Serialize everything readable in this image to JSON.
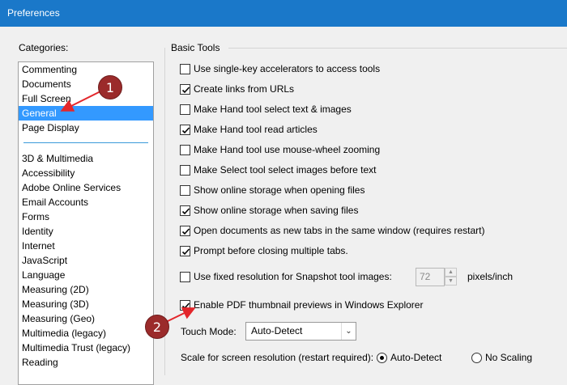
{
  "window": {
    "title": "Preferences"
  },
  "categories": {
    "label": "Categories:",
    "top_items": [
      {
        "label": "Commenting",
        "selected": false
      },
      {
        "label": "Documents",
        "selected": false
      },
      {
        "label": "Full Screen",
        "selected": false
      },
      {
        "label": "General",
        "selected": true
      },
      {
        "label": "Page Display",
        "selected": false
      }
    ],
    "items": [
      {
        "label": "3D & Multimedia"
      },
      {
        "label": "Accessibility"
      },
      {
        "label": "Adobe Online Services"
      },
      {
        "label": "Email Accounts"
      },
      {
        "label": "Forms"
      },
      {
        "label": "Identity"
      },
      {
        "label": "Internet"
      },
      {
        "label": "JavaScript"
      },
      {
        "label": "Language"
      },
      {
        "label": "Measuring (2D)"
      },
      {
        "label": "Measuring (3D)"
      },
      {
        "label": "Measuring (Geo)"
      },
      {
        "label": "Multimedia (legacy)"
      },
      {
        "label": "Multimedia Trust (legacy)"
      },
      {
        "label": "Reading"
      }
    ]
  },
  "basic_tools": {
    "title": "Basic Tools",
    "options": [
      {
        "label": "Use single-key accelerators to access tools",
        "checked": false
      },
      {
        "label": "Create links from URLs",
        "checked": true
      },
      {
        "label": "Make Hand tool select text & images",
        "checked": false
      },
      {
        "label": "Make Hand tool read articles",
        "checked": true
      },
      {
        "label": "Make Hand tool use mouse-wheel zooming",
        "checked": false
      },
      {
        "label": "Make Select tool select images before text",
        "checked": false
      },
      {
        "label": "Show online storage when opening files",
        "checked": false
      },
      {
        "label": "Show online storage when saving files",
        "checked": true
      },
      {
        "label": "Open documents as new tabs in the same window (requires restart)",
        "checked": true
      },
      {
        "label": "Prompt before closing multiple tabs.",
        "checked": true
      }
    ],
    "snapshot": {
      "label": "Use fixed resolution for Snapshot tool images:",
      "checked": false,
      "value": "72",
      "unit": "pixels/inch"
    },
    "thumbnail": {
      "label": "Enable PDF thumbnail previews in Windows Explorer",
      "checked": true
    },
    "touch_mode": {
      "label": "Touch Mode:",
      "value": "Auto-Detect"
    },
    "scale": {
      "label": "Scale for screen resolution (restart required):",
      "options": [
        {
          "label": "Auto-Detect",
          "checked": true
        },
        {
          "label": "No Scaling",
          "checked": false
        }
      ]
    }
  },
  "annotations": {
    "marker_1": "1",
    "marker_2": "2",
    "arrow_color": "#e3262b"
  }
}
